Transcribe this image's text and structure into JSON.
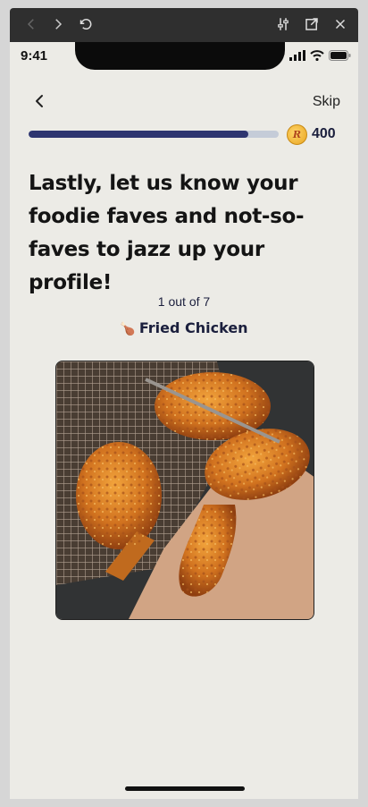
{
  "browser": {
    "icons": [
      "back-arrow-icon",
      "forward-arrow-icon",
      "reload-icon",
      "sliders-icon",
      "open-external-icon",
      "close-icon"
    ]
  },
  "status_bar": {
    "time": "9:41",
    "icons": [
      "signal-icon",
      "wifi-icon",
      "battery-icon"
    ]
  },
  "header": {
    "skip_label": "Skip",
    "points": "400",
    "coin_letter": "R"
  },
  "progress": {
    "fraction": 0.88,
    "fill_color": "#2e3570",
    "track_color": "#c5ccd8"
  },
  "main": {
    "headline": "Lastly, let us know your foodie faves and not-so-faves to jazz up your profile!",
    "counter": "1 out of 7",
    "food_emoji": "🍗",
    "food_name": "Fried Chicken"
  },
  "colors": {
    "background": "#ecebe6",
    "accent": "#1b1f3d"
  }
}
